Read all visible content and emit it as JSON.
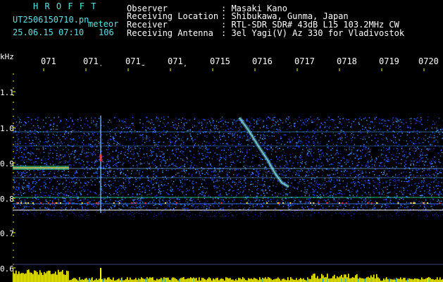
{
  "header": {
    "brand": "H R O F F T",
    "filename": "UT2506150710.pn",
    "type_tag": "meteor",
    "datetime": "25.06.15 07:10",
    "count": "106",
    "observer_label": "Observer",
    "observer_value": ": Masaki Kano",
    "location_label": "Receiving Location",
    "location_value": ": Shibukawa, Gunma, Japan",
    "receiver_label": "Receiver",
    "receiver_value": ": RTL-SDR SDR# 43dB L15 103.2MHz CW",
    "antenna_label": "Receiving Antenna",
    "antenna_value": ": 3el Yagi(V) Az 330 for Vladivostok"
  },
  "yaxis": {
    "unit": "kHz",
    "ticks": [
      "1.1",
      "1.0",
      "0.9",
      "0.8",
      "0.7",
      "0.6"
    ]
  },
  "xaxis": {
    "ticks": [
      "071",
      "0711",
      "0713",
      "0714",
      "0715",
      "0716",
      "0717",
      "0718",
      "0719",
      "0720"
    ],
    "display": [
      "071",
      "071̣",
      "071̱",
      "071̦",
      "0715",
      "0716",
      "0717",
      "0718",
      "0719",
      "0720"
    ]
  },
  "colors": {
    "background": "#000000",
    "header_cyan": "#5fe0e0",
    "noise_blue": "#1d2fd0",
    "signal_yellow": "#ffff00",
    "tick_marks": "#ffff00"
  }
}
